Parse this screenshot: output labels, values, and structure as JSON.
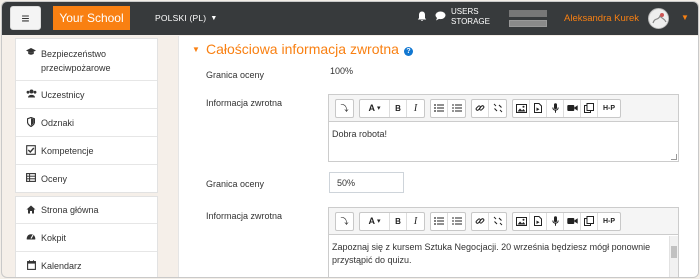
{
  "navbar": {
    "menu_icon": "hamburger-icon",
    "brand": "Your School",
    "language": "POLSKI (PL)",
    "notification_icon": "bell-icon",
    "message_icon": "chat-bubble-icon",
    "storage_line1": "USERS",
    "storage_line2": "STORAGE",
    "username": "Aleksandra Kurek",
    "accent_color": "#f98012"
  },
  "sidebar": {
    "group1": [
      {
        "icon": "graduation-cap-icon",
        "label": "Bezpieczeństwo przeciwpożarowe"
      },
      {
        "icon": "users-icon",
        "label": "Uczestnicy"
      },
      {
        "icon": "shield-icon",
        "label": "Odznaki"
      },
      {
        "icon": "check-square-icon",
        "label": "Kompetencje"
      },
      {
        "icon": "table-icon",
        "label": "Oceny"
      }
    ],
    "group2": [
      {
        "icon": "home-icon",
        "label": "Strona główna"
      },
      {
        "icon": "dashboard-icon",
        "label": "Kokpit"
      },
      {
        "icon": "calendar-icon",
        "label": "Kalendarz"
      }
    ]
  },
  "main": {
    "section_title": "Całościowa informacja zwrotna",
    "rows": [
      {
        "label": "Granica oceny",
        "value": "100%"
      },
      {
        "label": "Informacja zwrotna",
        "value": "Dobra robota!"
      },
      {
        "label": "Granica oceny",
        "value": "50%"
      },
      {
        "label": "Informacja zwrotna",
        "value": "Zapoznaj się z kursem Sztuka Negocjacji. 20 września będziesz mógł ponownie przystąpić do quizu."
      }
    ],
    "toolbar": {
      "collapse": "⤵",
      "style": "A",
      "style_caret": "▾",
      "bold": "B",
      "italic": "I",
      "h5p": "H-P"
    }
  }
}
